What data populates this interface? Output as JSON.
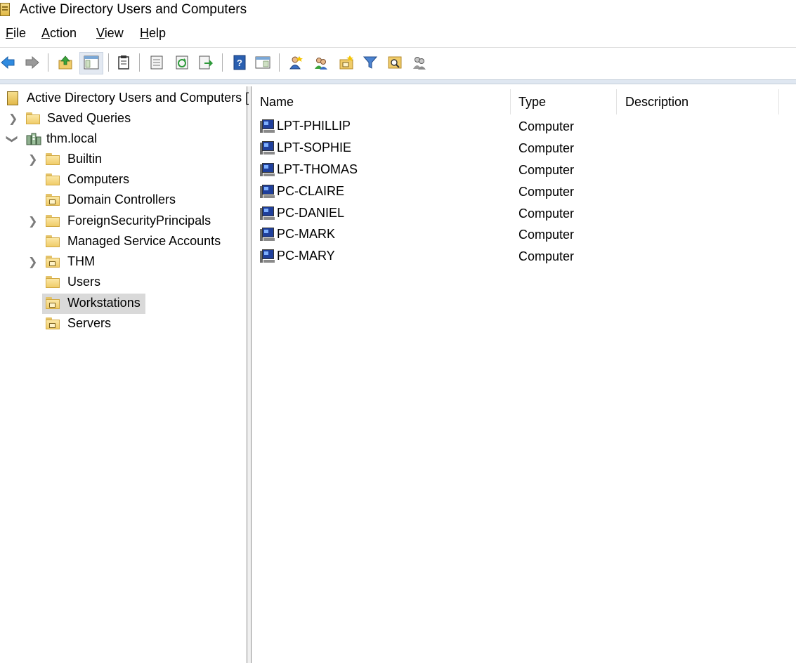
{
  "window": {
    "title": "Active Directory Users and Computers"
  },
  "menu": [
    {
      "accel": "F",
      "rest": "ile"
    },
    {
      "accel": "A",
      "rest": "ction"
    },
    {
      "accel": "V",
      "rest": "iew"
    },
    {
      "accel": "H",
      "rest": "elp"
    }
  ],
  "toolbar": {
    "icons": [
      "back-icon",
      "forward-icon",
      "up-icon",
      "show-console-tree-icon",
      "delete-icon",
      "properties-icon",
      "refresh-icon",
      "export-list-icon",
      "help-icon",
      "action-pane-icon",
      "new-user-icon",
      "new-group-icon",
      "new-ou-icon",
      "filter-icon",
      "find-icon",
      "add-to-group-icon"
    ]
  },
  "tree": {
    "root": "Active Directory Users and Computers [",
    "saved_queries": "Saved Queries",
    "domain": "thm.local",
    "containers": [
      {
        "label": "Builtin"
      },
      {
        "label": "Computers"
      },
      {
        "label": "Domain Controllers"
      },
      {
        "label": "ForeignSecurityPrincipals"
      },
      {
        "label": "Managed Service Accounts"
      },
      {
        "label": "THM"
      },
      {
        "label": "Users"
      },
      {
        "label": "Workstations"
      },
      {
        "label": "Servers"
      }
    ],
    "selected": "Workstations"
  },
  "list": {
    "columns": {
      "name": "Name",
      "type": "Type",
      "description": "Description"
    },
    "rows": [
      {
        "name": "LPT-PHILLIP",
        "type": "Computer",
        "description": ""
      },
      {
        "name": "LPT-SOPHIE",
        "type": "Computer",
        "description": ""
      },
      {
        "name": "LPT-THOMAS",
        "type": "Computer",
        "description": ""
      },
      {
        "name": "PC-CLAIRE",
        "type": "Computer",
        "description": ""
      },
      {
        "name": "PC-DANIEL",
        "type": "Computer",
        "description": ""
      },
      {
        "name": "PC-MARK",
        "type": "Computer",
        "description": ""
      },
      {
        "name": "PC-MARY",
        "type": "Computer",
        "description": ""
      }
    ]
  }
}
